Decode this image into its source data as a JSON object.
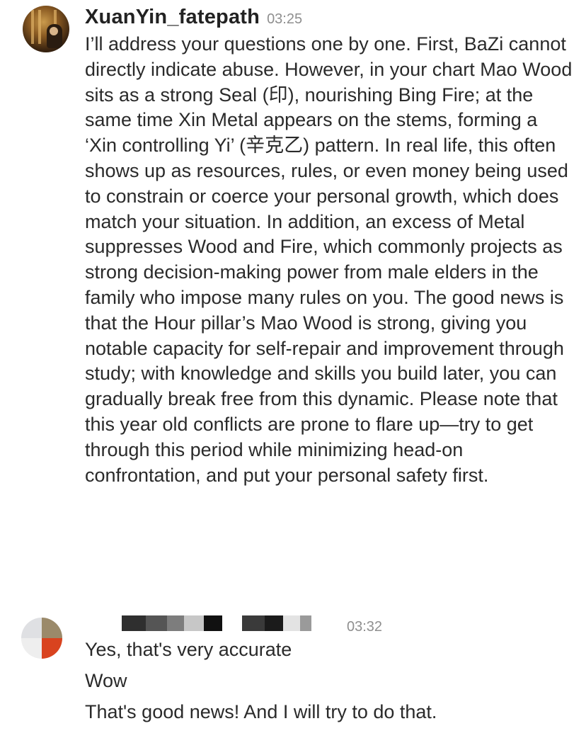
{
  "messages": [
    {
      "username": "XuanYin_fatepath",
      "time": "03:25",
      "avatar_icon": "user-avatar-portrait",
      "text": "I’ll address your questions one by one. First, BaZi cannot directly indicate abuse. However, in your chart Mao Wood sits as a strong Seal (印), nourishing Bing Fire; at the same time Xin Metal appears on the stems, forming a ‘Xin controlling Yi’ (辛克乙) pattern. In real life, this often shows up as resources, rules, or even money being used to constrain or coerce your personal growth, which does match your situation. In addition, an excess of Metal suppresses Wood and Fire, which commonly projects as strong decision-making power from male elders in the family who impose many rules on you. The good news is that the Hour pillar’s Mao Wood is strong, giving you notable capacity for self-repair and improvement through study; with knowledge and skills you build later, you can gradually break free from this dynamic. Please note that this year old conflicts are prone to flare up—try to get through this period while minimizing head-on confrontation, and put your personal safety first."
    },
    {
      "username_redacted": true,
      "time": "03:32",
      "avatar_icon": "user-avatar-abstract",
      "lines": [
        "Yes, that's very accurate",
        "Wow",
        "That's good news! And I will try to do that."
      ]
    }
  ]
}
